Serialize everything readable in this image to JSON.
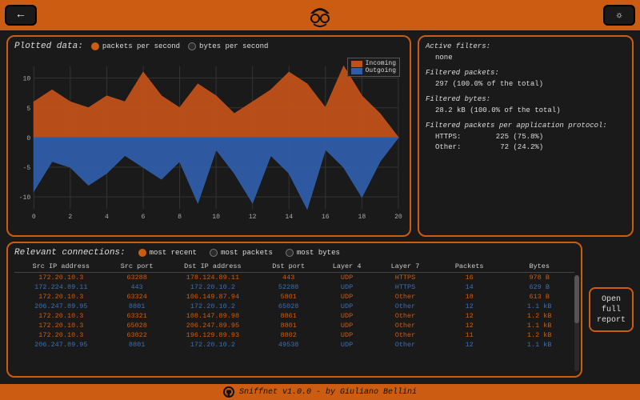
{
  "colors": {
    "accent": "#cc5c11",
    "incoming": "#c05018",
    "outgoing": "#2f5da8",
    "hl": "#cc5c11",
    "norm": "#3b6fb5"
  },
  "topbar": {
    "back_label": "←",
    "theme_label": "☀"
  },
  "plot": {
    "title": "Plotted data:",
    "opt_packets": "packets per second",
    "opt_bytes": "bytes per second",
    "legend_in": "Incoming",
    "legend_out": "Outgoing"
  },
  "chart_data": {
    "type": "area",
    "xlabel": "",
    "ylabel": "",
    "xlim": [
      0,
      20
    ],
    "ylim": [
      -12,
      12
    ],
    "x_ticks": [
      0,
      2,
      4,
      6,
      8,
      10,
      12,
      14,
      16,
      18,
      20
    ],
    "y_ticks": [
      -10,
      -5,
      0,
      5,
      10
    ],
    "x": [
      0,
      1,
      2,
      3,
      4,
      5,
      6,
      7,
      8,
      9,
      10,
      11,
      12,
      13,
      14,
      15,
      16,
      17,
      18,
      19,
      20
    ],
    "series": [
      {
        "name": "Incoming",
        "color": "#c05018",
        "values": [
          6,
          8,
          6,
          5,
          7,
          6,
          11,
          7,
          5,
          9,
          7,
          4,
          6,
          8,
          11,
          9,
          5,
          12,
          7,
          4,
          0
        ]
      },
      {
        "name": "Outgoing",
        "color": "#2f5da8",
        "values": [
          -9,
          -4,
          -5,
          -8,
          -6,
          -3,
          -5,
          -7,
          -4,
          -11,
          -2,
          -6,
          -11,
          -3,
          -6,
          -12,
          -2,
          -5,
          -10,
          -4,
          0
        ]
      }
    ]
  },
  "filters": {
    "active_label": "Active filters:",
    "active_value": "none",
    "packets_label": "Filtered packets:",
    "packets_value": "297 (100.0% of the total)",
    "bytes_label": "Filtered bytes:",
    "bytes_value": "28.2 kB (100.0% of the total)",
    "proto_label": "Filtered packets per application protocol:",
    "rows": [
      {
        "name": "HTTPS:",
        "count": "225",
        "pct": "(75.8%)"
      },
      {
        "name": "Other:",
        "count": "72",
        "pct": "(24.2%)"
      }
    ]
  },
  "conn": {
    "title": "Relevant connections:",
    "opt_recent": "most recent",
    "opt_packets": "most packets",
    "opt_bytes": "most bytes",
    "headers": [
      "Src IP address",
      "Src port",
      "Dst IP address",
      "Dst port",
      "Layer 4",
      "Layer 7",
      "Packets",
      "Bytes"
    ],
    "rows": [
      {
        "hl": true,
        "c": [
          "172.20.10.3",
          "63288",
          "178.124.89.11",
          "443",
          "UDP",
          "HTTPS",
          "16",
          "978  B"
        ]
      },
      {
        "hl": false,
        "c": [
          "172.224.89.11",
          "443",
          "172.20.10.2",
          "52288",
          "UDP",
          "HTTPS",
          "14",
          "629  B"
        ]
      },
      {
        "hl": true,
        "c": [
          "172.20.10.3",
          "63324",
          "106.149.87.94",
          "5801",
          "UDP",
          "Other",
          "18",
          "613  B"
        ]
      },
      {
        "hl": false,
        "c": [
          "206.247.89.95",
          "8801",
          "172.20.10.2",
          "65028",
          "UDP",
          "Other",
          "12",
          "1.1 kB"
        ]
      },
      {
        "hl": true,
        "c": [
          "172.20.10.3",
          "63321",
          "108.147.89.98",
          "8861",
          "UDP",
          "Other",
          "12",
          "1.2 kB"
        ]
      },
      {
        "hl": true,
        "c": [
          "172.20.10.3",
          "65028",
          "206.247.89.95",
          "8801",
          "UDP",
          "Other",
          "12",
          "1.1 kB"
        ]
      },
      {
        "hl": true,
        "c": [
          "172.20.10.3",
          "63022",
          "196.129.89.93",
          "8802",
          "UDP",
          "Other",
          "11",
          "1.2 kB"
        ]
      },
      {
        "hl": false,
        "c": [
          "206.247.89.95",
          "8801",
          "172.20.10.2",
          "49538",
          "UDP",
          "Other",
          "12",
          "1.1 kB"
        ]
      }
    ]
  },
  "report_btn": "Open\nfull\nreport",
  "footer": {
    "text": "Sniffnet v1.0.0 - by Giuliano Bellini"
  }
}
